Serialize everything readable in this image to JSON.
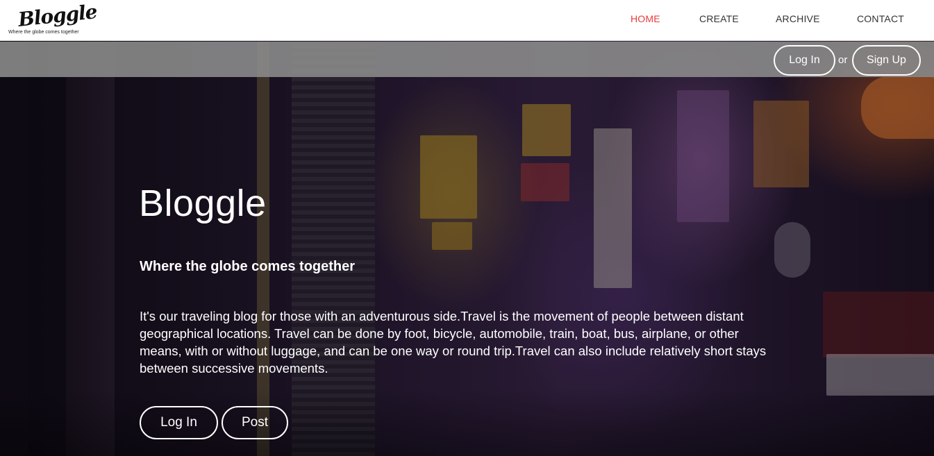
{
  "brand": {
    "logo_text": "Bloggle",
    "logo_tagline": "Where the globe comes together"
  },
  "nav": {
    "items": [
      {
        "label": "HOME",
        "active": true
      },
      {
        "label": "CREATE",
        "active": false
      },
      {
        "label": "ARCHIVE",
        "active": false
      },
      {
        "label": "CONTACT",
        "active": false
      }
    ]
  },
  "auth": {
    "login_label": "Log In",
    "separator": "or",
    "signup_label": "Sign Up"
  },
  "hero": {
    "title": "Bloggle",
    "subtitle": "Where the globe comes together",
    "description": "It's our traveling blog for those with an adventurous side.Travel is the movement of people between distant geographical locations. Travel can be done by foot, bicycle, automobile, train, boat, bus, airplane, or other means, with or without luggage, and can be one way or round trip.Travel can also include relatively short stays between successive movements.",
    "login_label": "Log In",
    "post_label": "Post"
  },
  "colors": {
    "active_nav": "#e83c3c",
    "auth_bar": "#878787",
    "text_light": "#ffffff"
  }
}
